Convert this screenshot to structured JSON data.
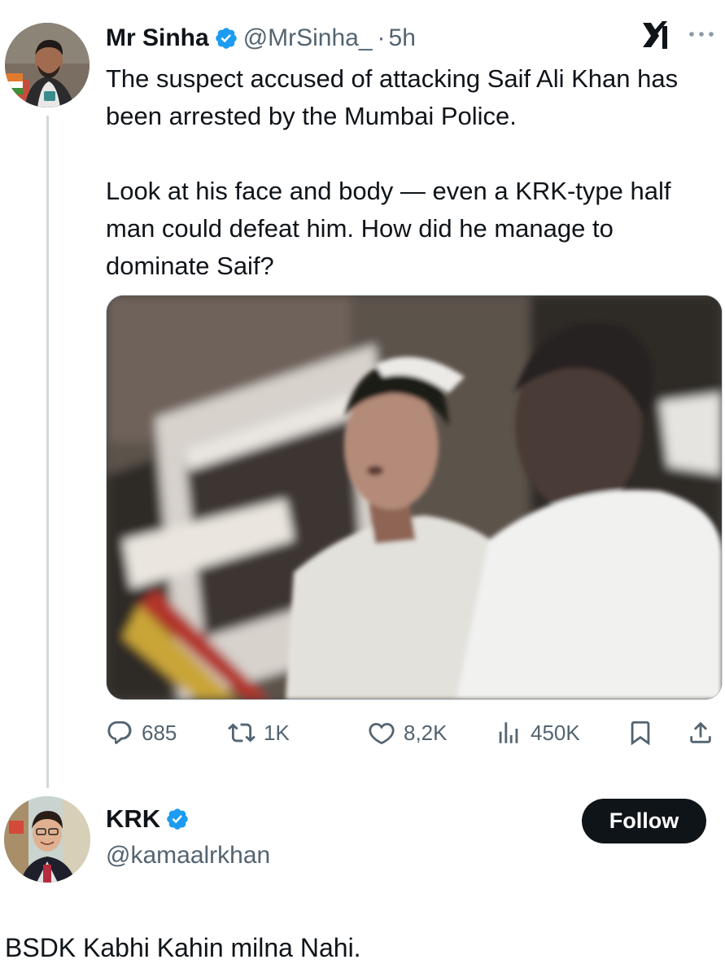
{
  "original_tweet": {
    "author": {
      "name": "Mr Sinha",
      "handle": "@MrSinha_",
      "verified": true,
      "avatar": "avatar-photo"
    },
    "separator": "·",
    "time": "5h",
    "paragraphs": [
      "The suspect accused of attacking Saif Ali Khan has been arrested by the Mumbai Police.",
      "Look at his face and body — even a KRK-type half man could defeat him. How did he manage to dominate Saif?"
    ],
    "media": {
      "type": "photo",
      "icon": "photo"
    },
    "stats": {
      "replies": "685",
      "reposts": "1K",
      "likes": "8,2K",
      "views": "450K"
    },
    "icons": [
      "x-logo-icon",
      "more-options-icon",
      "reply-icon",
      "repost-icon",
      "like-icon",
      "views-icon",
      "bookmark-icon",
      "share-icon"
    ]
  },
  "reply_author": {
    "name": "KRK",
    "handle": "@kamaalrkhan",
    "verified": true,
    "follow_label": "Follow"
  },
  "reply_text": "BSDK Kabhi Kahin milna Nahi.",
  "colors": {
    "text": "#0f1419",
    "secondary": "#536471",
    "verified": "#1d9bf0",
    "thread_line": "#cfd9de",
    "follow_bg": "#0f1419"
  }
}
